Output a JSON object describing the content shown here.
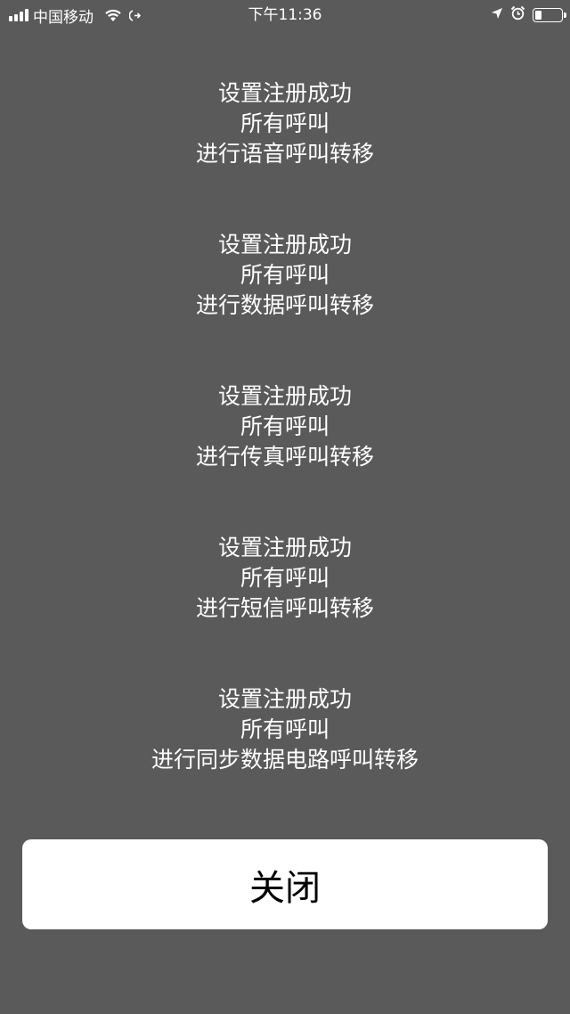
{
  "status_bar": {
    "signal_bars": 4,
    "carrier": "中国移动",
    "time": "下午11:36",
    "battery_level": 0.25,
    "icons": [
      "signal-icon",
      "wifi-icon",
      "call-forwarding-icon",
      "location-arrow-icon",
      "alarm-icon",
      "battery-icon"
    ]
  },
  "message": {
    "blocks": [
      {
        "lines": [
          "设置注册成功",
          "所有呼叫",
          "进行语音呼叫转移"
        ]
      },
      {
        "lines": [
          "设置注册成功",
          "所有呼叫",
          "进行数据呼叫转移"
        ]
      },
      {
        "lines": [
          "设置注册成功",
          "所有呼叫",
          "进行传真呼叫转移"
        ]
      },
      {
        "lines": [
          "设置注册成功",
          "所有呼叫",
          "进行短信呼叫转移"
        ]
      },
      {
        "lines": [
          "设置注册成功",
          "所有呼叫",
          "进行同步数据电路呼叫转移"
        ]
      }
    ]
  },
  "close_button": {
    "label": "关闭"
  },
  "colors": {
    "background": "#5a5a5a",
    "text": "#ffffff",
    "button_bg": "#ffffff",
    "button_text": "#000000"
  }
}
